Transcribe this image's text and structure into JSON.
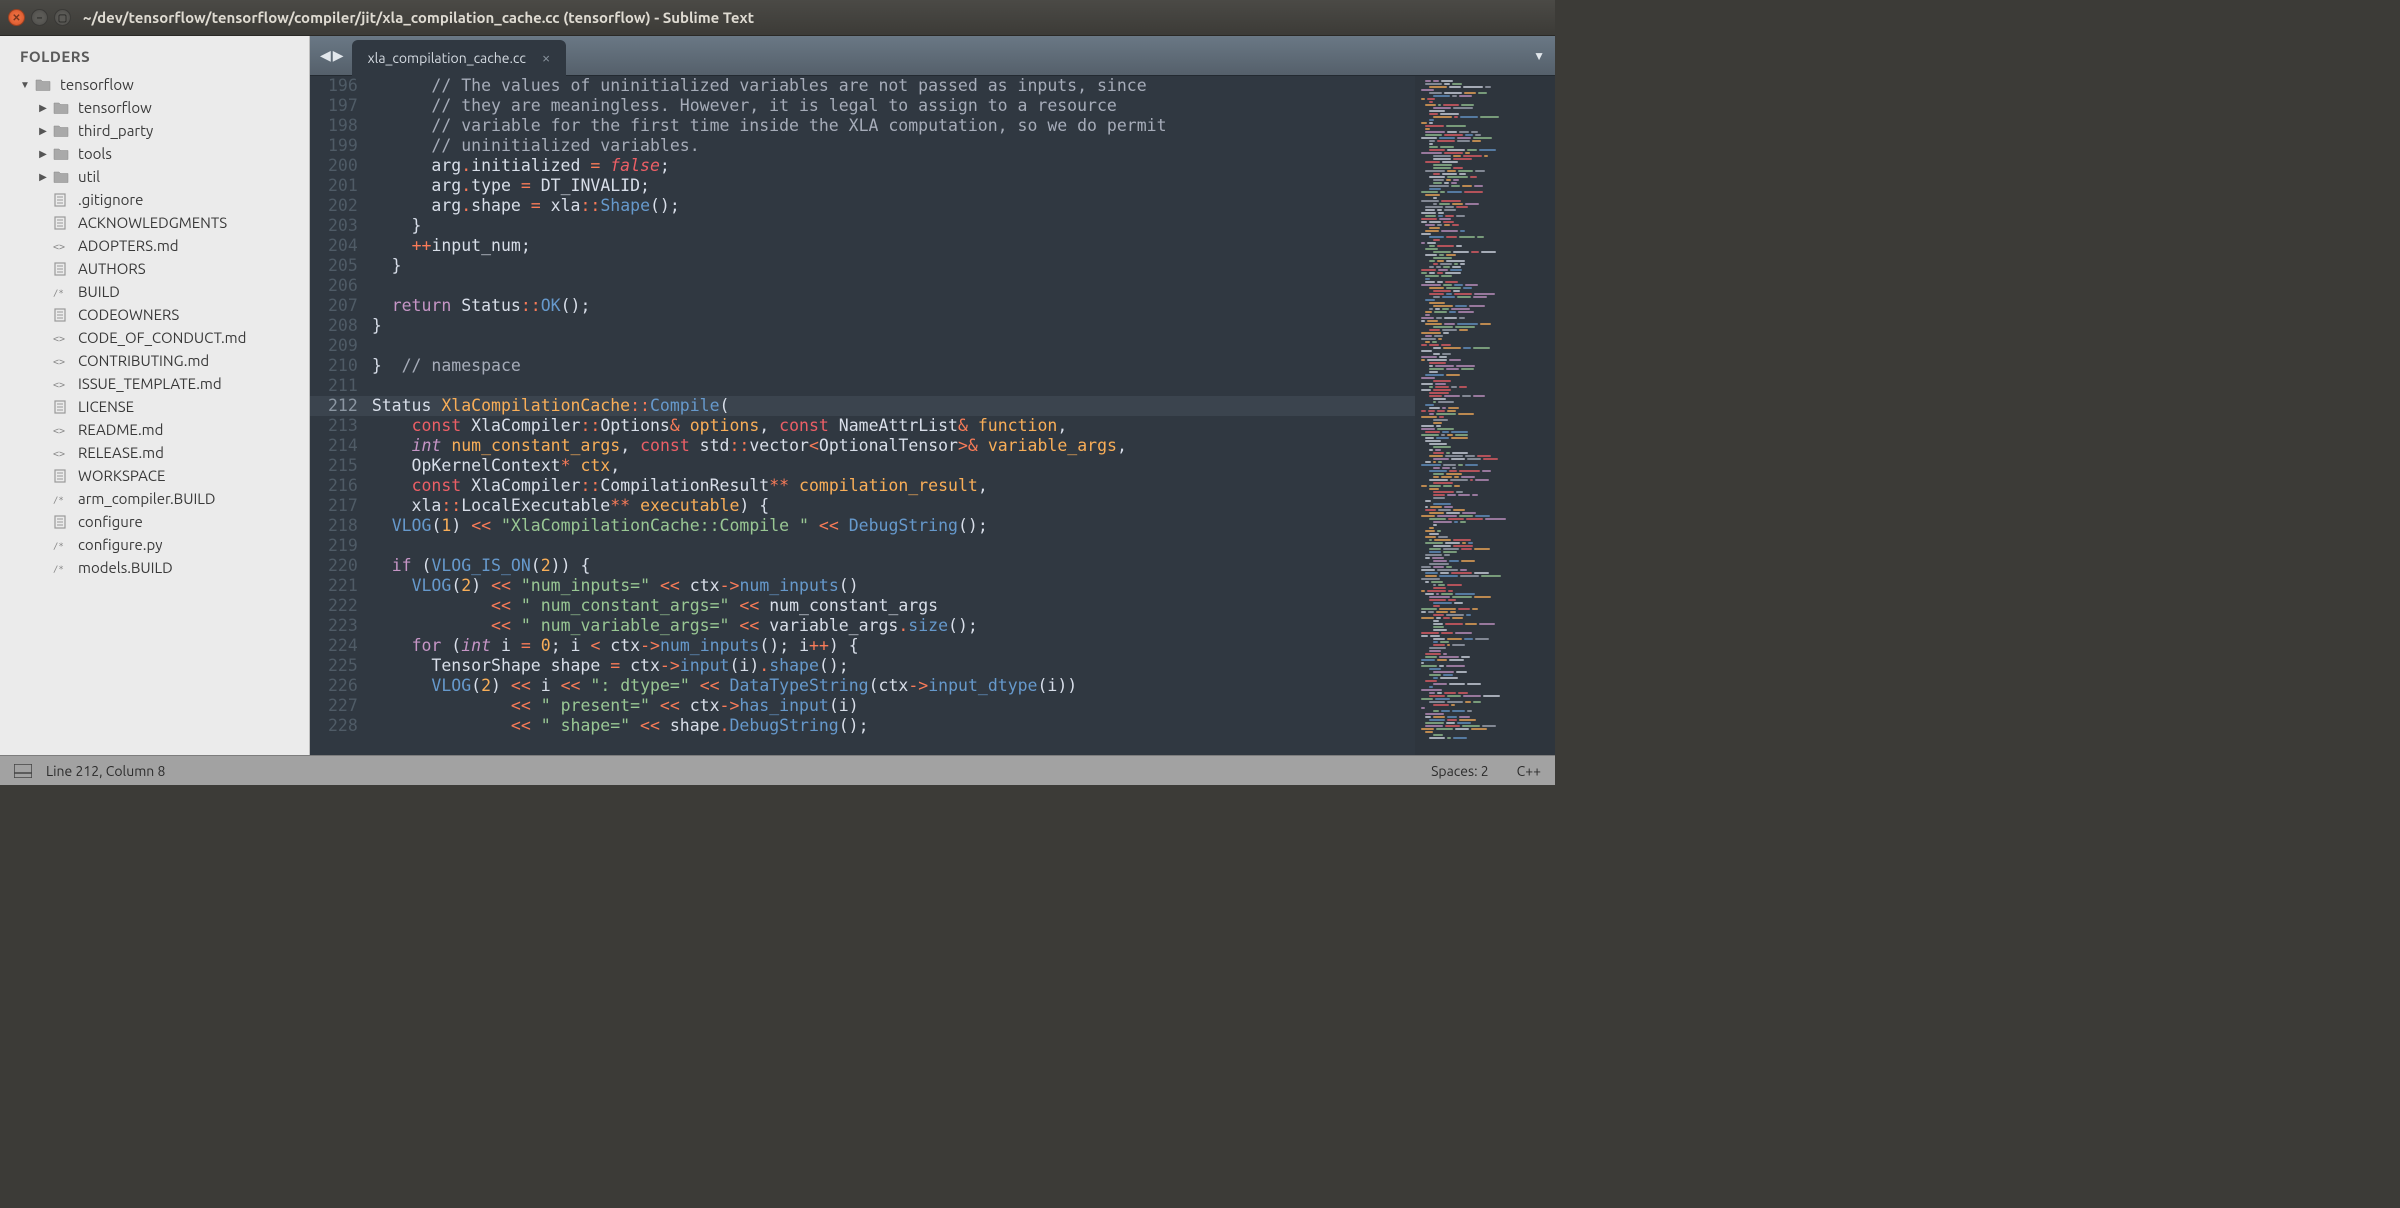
{
  "window": {
    "title": "~/dev/tensorflow/tensorflow/compiler/jit/xla_compilation_cache.cc (tensorflow) - Sublime Text"
  },
  "sidebar": {
    "header": "FOLDERS",
    "root": {
      "name": "tensorflow",
      "expanded": true
    },
    "folders": [
      {
        "name": "tensorflow"
      },
      {
        "name": "third_party"
      },
      {
        "name": "tools"
      },
      {
        "name": "util"
      }
    ],
    "files": [
      {
        "name": ".gitignore",
        "type": "text"
      },
      {
        "name": "ACKNOWLEDGMENTS",
        "type": "text"
      },
      {
        "name": "ADOPTERS.md",
        "type": "md"
      },
      {
        "name": "AUTHORS",
        "type": "text"
      },
      {
        "name": "BUILD",
        "type": "code"
      },
      {
        "name": "CODEOWNERS",
        "type": "text"
      },
      {
        "name": "CODE_OF_CONDUCT.md",
        "type": "md"
      },
      {
        "name": "CONTRIBUTING.md",
        "type": "md"
      },
      {
        "name": "ISSUE_TEMPLATE.md",
        "type": "md"
      },
      {
        "name": "LICENSE",
        "type": "text"
      },
      {
        "name": "README.md",
        "type": "md"
      },
      {
        "name": "RELEASE.md",
        "type": "md"
      },
      {
        "name": "WORKSPACE",
        "type": "text"
      },
      {
        "name": "arm_compiler.BUILD",
        "type": "code"
      },
      {
        "name": "configure",
        "type": "text"
      },
      {
        "name": "configure.py",
        "type": "code"
      },
      {
        "name": "models.BUILD",
        "type": "code"
      }
    ]
  },
  "tabs": {
    "active": "xla_compilation_cache.cc"
  },
  "editor": {
    "first_line_number": 196,
    "highlighted_line": 212,
    "lines": [
      [
        [
          "comment",
          "      // The values of uninitialized variables are not passed as inputs, since"
        ]
      ],
      [
        [
          "comment",
          "      // they are meaningless. However, it is legal to assign to a resource"
        ]
      ],
      [
        [
          "comment",
          "      // variable for the first time inside the XLA computation, so we do permit"
        ]
      ],
      [
        [
          "comment",
          "      // uninitialized variables."
        ]
      ],
      [
        [
          "var",
          "      arg"
        ],
        [
          "op",
          "."
        ],
        [
          "var",
          "initialized"
        ],
        [
          "var",
          " "
        ],
        [
          "op",
          "="
        ],
        [
          "var",
          " "
        ],
        [
          "bool",
          "false"
        ],
        [
          "var",
          ";"
        ]
      ],
      [
        [
          "var",
          "      arg"
        ],
        [
          "op",
          "."
        ],
        [
          "var",
          "type"
        ],
        [
          "var",
          " "
        ],
        [
          "op",
          "="
        ],
        [
          "var",
          " DT_INVALID;"
        ]
      ],
      [
        [
          "var",
          "      arg"
        ],
        [
          "op",
          "."
        ],
        [
          "var",
          "shape"
        ],
        [
          "var",
          " "
        ],
        [
          "op",
          "="
        ],
        [
          "var",
          " xla"
        ],
        [
          "op",
          "::"
        ],
        [
          "func",
          "Shape"
        ],
        [
          "var",
          "();"
        ]
      ],
      [
        [
          "var",
          "    }"
        ]
      ],
      [
        [
          "var",
          "    "
        ],
        [
          "op",
          "++"
        ],
        [
          "var",
          "input_num;"
        ]
      ],
      [
        [
          "var",
          "  }"
        ]
      ],
      [
        [
          "var",
          ""
        ]
      ],
      [
        [
          "var",
          "  "
        ],
        [
          "keyword",
          "return"
        ],
        [
          "var",
          " Status"
        ],
        [
          "op",
          "::"
        ],
        [
          "func",
          "OK"
        ],
        [
          "var",
          "();"
        ]
      ],
      [
        [
          "var",
          "}"
        ]
      ],
      [
        [
          "var",
          ""
        ]
      ],
      [
        [
          "var",
          "}  "
        ],
        [
          "comment",
          "// namespace"
        ]
      ],
      [
        [
          "var",
          ""
        ]
      ],
      [
        [
          "var",
          "Status "
        ],
        [
          "class",
          "XlaCompilationCache"
        ],
        [
          "op",
          "::"
        ],
        [
          "func",
          "Compile"
        ],
        [
          "var",
          "("
        ]
      ],
      [
        [
          "var",
          "    "
        ],
        [
          "storage",
          "const"
        ],
        [
          "var",
          " XlaCompiler"
        ],
        [
          "op",
          "::"
        ],
        [
          "var",
          "Options"
        ],
        [
          "op",
          "&"
        ],
        [
          "var",
          " "
        ],
        [
          "param",
          "options"
        ],
        [
          "var",
          ", "
        ],
        [
          "storage",
          "const"
        ],
        [
          "var",
          " NameAttrList"
        ],
        [
          "op",
          "&"
        ],
        [
          "var",
          " "
        ],
        [
          "param",
          "function"
        ],
        [
          "var",
          ","
        ]
      ],
      [
        [
          "var",
          "    "
        ],
        [
          "type",
          "int"
        ],
        [
          "var",
          " "
        ],
        [
          "param",
          "num_constant_args"
        ],
        [
          "var",
          ", "
        ],
        [
          "storage",
          "const"
        ],
        [
          "var",
          " std"
        ],
        [
          "op",
          "::"
        ],
        [
          "var",
          "vector"
        ],
        [
          "op",
          "<"
        ],
        [
          "var",
          "OptionalTensor"
        ],
        [
          "op",
          ">&"
        ],
        [
          "var",
          " "
        ],
        [
          "param",
          "variable_args"
        ],
        [
          "var",
          ","
        ]
      ],
      [
        [
          "var",
          "    OpKernelContext"
        ],
        [
          "op",
          "*"
        ],
        [
          "var",
          " "
        ],
        [
          "param",
          "ctx"
        ],
        [
          "var",
          ","
        ]
      ],
      [
        [
          "var",
          "    "
        ],
        [
          "storage",
          "const"
        ],
        [
          "var",
          " XlaCompiler"
        ],
        [
          "op",
          "::"
        ],
        [
          "var",
          "CompilationResult"
        ],
        [
          "op",
          "**"
        ],
        [
          "var",
          " "
        ],
        [
          "param",
          "compilation_result"
        ],
        [
          "var",
          ","
        ]
      ],
      [
        [
          "var",
          "    xla"
        ],
        [
          "op",
          "::"
        ],
        [
          "var",
          "LocalExecutable"
        ],
        [
          "op",
          "**"
        ],
        [
          "var",
          " "
        ],
        [
          "param",
          "executable"
        ],
        [
          "var",
          ") {"
        ]
      ],
      [
        [
          "var",
          "  "
        ],
        [
          "func",
          "VLOG"
        ],
        [
          "var",
          "("
        ],
        [
          "num",
          "1"
        ],
        [
          "var",
          ") "
        ],
        [
          "op",
          "<<"
        ],
        [
          "var",
          " "
        ],
        [
          "string",
          "\"XlaCompilationCache::Compile \""
        ],
        [
          "var",
          " "
        ],
        [
          "op",
          "<<"
        ],
        [
          "var",
          " "
        ],
        [
          "func",
          "DebugString"
        ],
        [
          "var",
          "();"
        ]
      ],
      [
        [
          "var",
          ""
        ]
      ],
      [
        [
          "var",
          "  "
        ],
        [
          "keyword",
          "if"
        ],
        [
          "var",
          " ("
        ],
        [
          "func",
          "VLOG_IS_ON"
        ],
        [
          "var",
          "("
        ],
        [
          "num",
          "2"
        ],
        [
          "var",
          ")) {"
        ]
      ],
      [
        [
          "var",
          "    "
        ],
        [
          "func",
          "VLOG"
        ],
        [
          "var",
          "("
        ],
        [
          "num",
          "2"
        ],
        [
          "var",
          ") "
        ],
        [
          "op",
          "<<"
        ],
        [
          "var",
          " "
        ],
        [
          "string",
          "\"num_inputs=\""
        ],
        [
          "var",
          " "
        ],
        [
          "op",
          "<<"
        ],
        [
          "var",
          " ctx"
        ],
        [
          "op",
          "->"
        ],
        [
          "func",
          "num_inputs"
        ],
        [
          "var",
          "()"
        ]
      ],
      [
        [
          "var",
          "            "
        ],
        [
          "op",
          "<<"
        ],
        [
          "var",
          " "
        ],
        [
          "string",
          "\" num_constant_args=\""
        ],
        [
          "var",
          " "
        ],
        [
          "op",
          "<<"
        ],
        [
          "var",
          " num_constant_args"
        ]
      ],
      [
        [
          "var",
          "            "
        ],
        [
          "op",
          "<<"
        ],
        [
          "var",
          " "
        ],
        [
          "string",
          "\" num_variable_args=\""
        ],
        [
          "var",
          " "
        ],
        [
          "op",
          "<<"
        ],
        [
          "var",
          " variable_args"
        ],
        [
          "op",
          "."
        ],
        [
          "func",
          "size"
        ],
        [
          "var",
          "();"
        ]
      ],
      [
        [
          "var",
          "    "
        ],
        [
          "keyword",
          "for"
        ],
        [
          "var",
          " ("
        ],
        [
          "type",
          "int"
        ],
        [
          "var",
          " i "
        ],
        [
          "op",
          "="
        ],
        [
          "var",
          " "
        ],
        [
          "num",
          "0"
        ],
        [
          "var",
          "; i "
        ],
        [
          "op",
          "<"
        ],
        [
          "var",
          " ctx"
        ],
        [
          "op",
          "->"
        ],
        [
          "func",
          "num_inputs"
        ],
        [
          "var",
          "(); i"
        ],
        [
          "op",
          "++"
        ],
        [
          "var",
          ") {"
        ]
      ],
      [
        [
          "var",
          "      TensorShape shape "
        ],
        [
          "op",
          "="
        ],
        [
          "var",
          " ctx"
        ],
        [
          "op",
          "->"
        ],
        [
          "func",
          "input"
        ],
        [
          "var",
          "(i)"
        ],
        [
          "op",
          "."
        ],
        [
          "func",
          "shape"
        ],
        [
          "var",
          "();"
        ]
      ],
      [
        [
          "var",
          "      "
        ],
        [
          "func",
          "VLOG"
        ],
        [
          "var",
          "("
        ],
        [
          "num",
          "2"
        ],
        [
          "var",
          ") "
        ],
        [
          "op",
          "<<"
        ],
        [
          "var",
          " i "
        ],
        [
          "op",
          "<<"
        ],
        [
          "var",
          " "
        ],
        [
          "string",
          "\": dtype=\""
        ],
        [
          "var",
          " "
        ],
        [
          "op",
          "<<"
        ],
        [
          "var",
          " "
        ],
        [
          "func",
          "DataTypeString"
        ],
        [
          "var",
          "(ctx"
        ],
        [
          "op",
          "->"
        ],
        [
          "func",
          "input_dtype"
        ],
        [
          "var",
          "(i))"
        ]
      ],
      [
        [
          "var",
          "              "
        ],
        [
          "op",
          "<<"
        ],
        [
          "var",
          " "
        ],
        [
          "string",
          "\" present=\""
        ],
        [
          "var",
          " "
        ],
        [
          "op",
          "<<"
        ],
        [
          "var",
          " ctx"
        ],
        [
          "op",
          "->"
        ],
        [
          "func",
          "has_input"
        ],
        [
          "var",
          "(i)"
        ]
      ],
      [
        [
          "var",
          "              "
        ],
        [
          "op",
          "<<"
        ],
        [
          "var",
          " "
        ],
        [
          "string",
          "\" shape=\""
        ],
        [
          "var",
          " "
        ],
        [
          "op",
          "<<"
        ],
        [
          "var",
          " shape"
        ],
        [
          "op",
          "."
        ],
        [
          "func",
          "DebugString"
        ],
        [
          "var",
          "();"
        ]
      ]
    ]
  },
  "status": {
    "cursor": "Line 212, Column 8",
    "spaces": "Spaces: 2",
    "lang": "C++"
  }
}
